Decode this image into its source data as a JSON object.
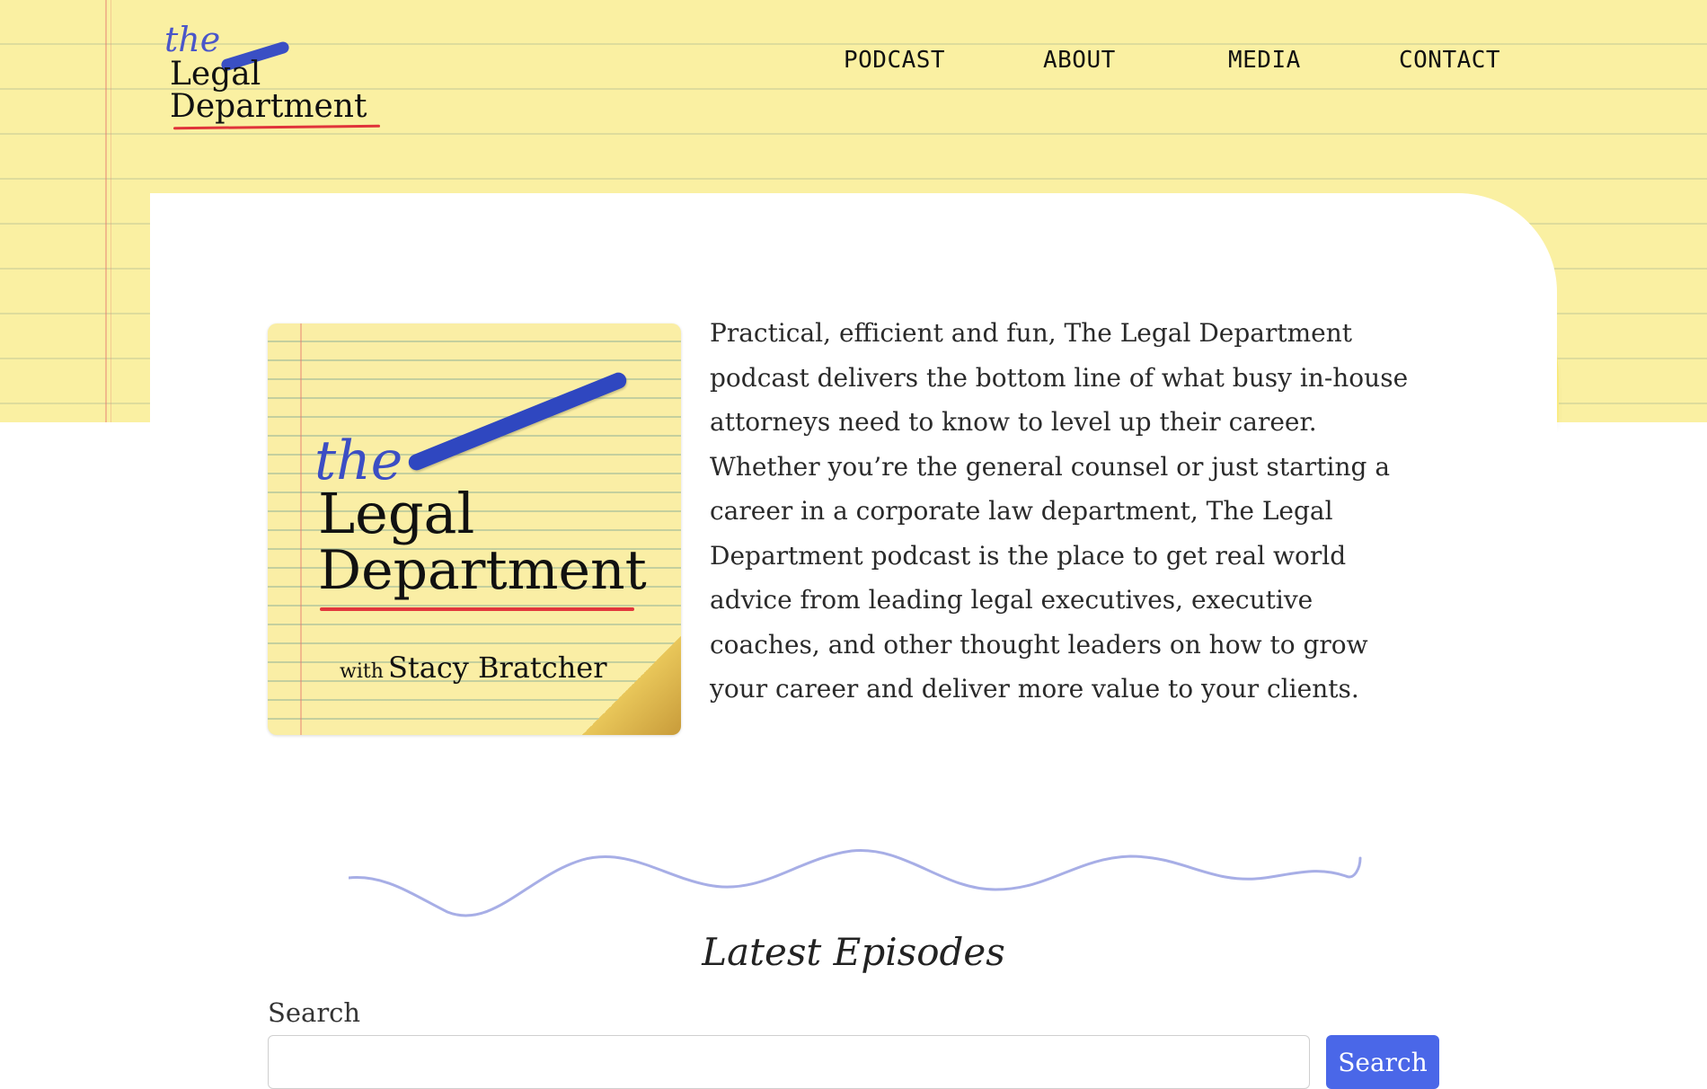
{
  "brand": {
    "logo_the": "the",
    "logo_line1": "Legal",
    "logo_line2": "Department",
    "pad_color": "#faf0a2",
    "accent_blue": "#3a4fc4",
    "accent_red": "#e0333a"
  },
  "nav": {
    "items": [
      {
        "label": "PODCAST"
      },
      {
        "label": "ABOUT"
      },
      {
        "label": "MEDIA"
      },
      {
        "label": "CONTACT"
      }
    ]
  },
  "cover": {
    "the": "the",
    "line1": "Legal",
    "line2": "Department",
    "with": "with",
    "host": "Stacy Bratcher"
  },
  "description": "Practical, efficient and fun, The Legal Department podcast delivers the bottom line of what busy in-house attorneys need to know to level up their career. Whether you’re the general counsel or just starting a career in a corporate law department, The Legal Department podcast is the place to get real world advice from leading legal executives, executive coaches, and other thought leaders on how to grow your career and deliver more value to your clients.",
  "episodes": {
    "heading": "Latest Episodes",
    "search_label": "Search",
    "search_value": "",
    "search_button": "Search",
    "button_color": "#4a67e8"
  }
}
